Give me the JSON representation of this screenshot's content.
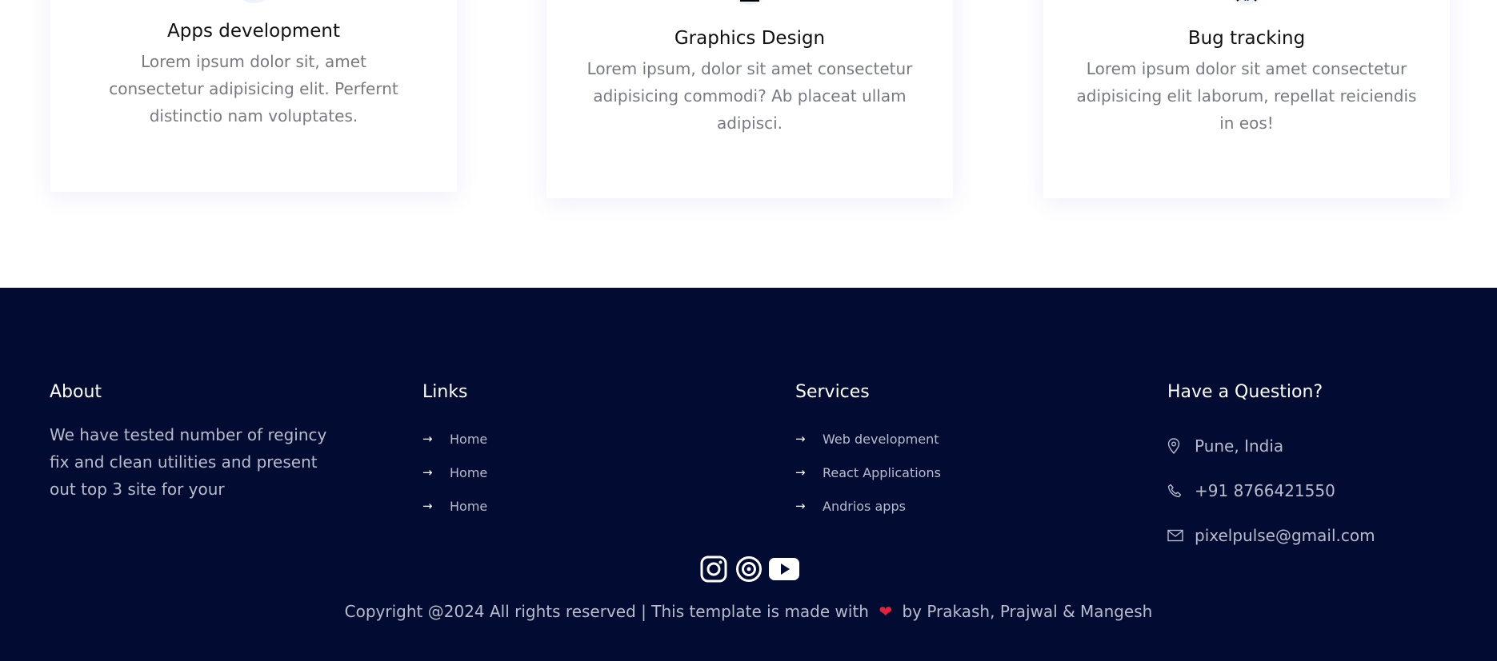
{
  "services": {
    "cards": [
      {
        "icon": "grid-icon",
        "title": "Apps development",
        "description": "Lorem ipsum dolor sit, amet consectetur adipisicing elit. Perfernt distinctio nam voluptates."
      },
      {
        "icon": "design-icon",
        "title": "Graphics Design",
        "description": "Lorem ipsum, dolor sit amet consectetur adipisicing commodi? Ab placeat ullam adipisci."
      },
      {
        "icon": "bug-icon",
        "title": "Bug tracking",
        "description": "Lorem ipsum dolor sit amet consectetur adipisicing elit laborum, repellat reiciendis in eos!"
      }
    ]
  },
  "footer": {
    "about": {
      "heading": "About",
      "text": "We have tested number of regincy fix and clean utilities and present out top 3 site for your"
    },
    "links": {
      "heading": "Links",
      "items": [
        "Home",
        "Home",
        "Home"
      ]
    },
    "services": {
      "heading": "Services",
      "items": [
        "Web development",
        "React Applications",
        "Andrios apps"
      ]
    },
    "question": {
      "heading": "Have a Question?",
      "location": "Pune, India",
      "phone": "+91 8766421550",
      "email": "pixelpulse@gmail.com"
    },
    "social": [
      "instagram-icon",
      "target-icon",
      "youtube-icon"
    ],
    "copyright": {
      "before": "Copyright @2024 All rights reserved | This template is made with",
      "heart": "❤",
      "after": "by Prakash, Prajwal & Mangesh"
    }
  },
  "colors": {
    "footer_bg": "#020b31",
    "heart": "#e0223a",
    "muted_text": "#b9bccb",
    "card_text": "#777a80"
  }
}
